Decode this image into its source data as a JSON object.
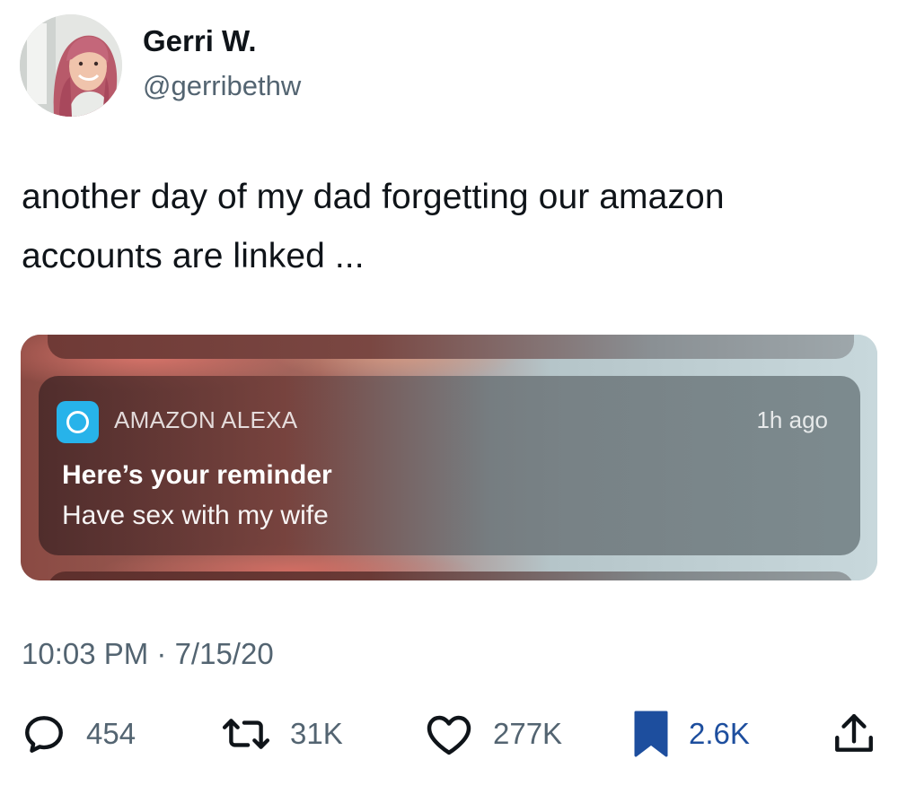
{
  "tweet": {
    "author": {
      "display_name": "Gerri W.",
      "handle": "@gerribethw"
    },
    "text": "another day of my dad forgetting our amazon accounts are linked ...",
    "timestamp": "10:03 PM · 7/15/20"
  },
  "media": {
    "notification": {
      "app_name": "AMAZON ALEXA",
      "time": "1h ago",
      "title": "Here’s your reminder",
      "body": "Have sex with my wife",
      "icon": "alexa-ring-icon",
      "icon_color": "#27b3ea"
    }
  },
  "actions": {
    "replies": {
      "icon": "reply-icon",
      "count": "454"
    },
    "retweets": {
      "icon": "retweet-icon",
      "count": "31K"
    },
    "likes": {
      "icon": "heart-icon",
      "count": "277K"
    },
    "bookmarks": {
      "icon": "bookmark-icon",
      "count": "2.6K",
      "active": true,
      "color": "#1d4e9e"
    },
    "share": {
      "icon": "share-icon"
    }
  }
}
